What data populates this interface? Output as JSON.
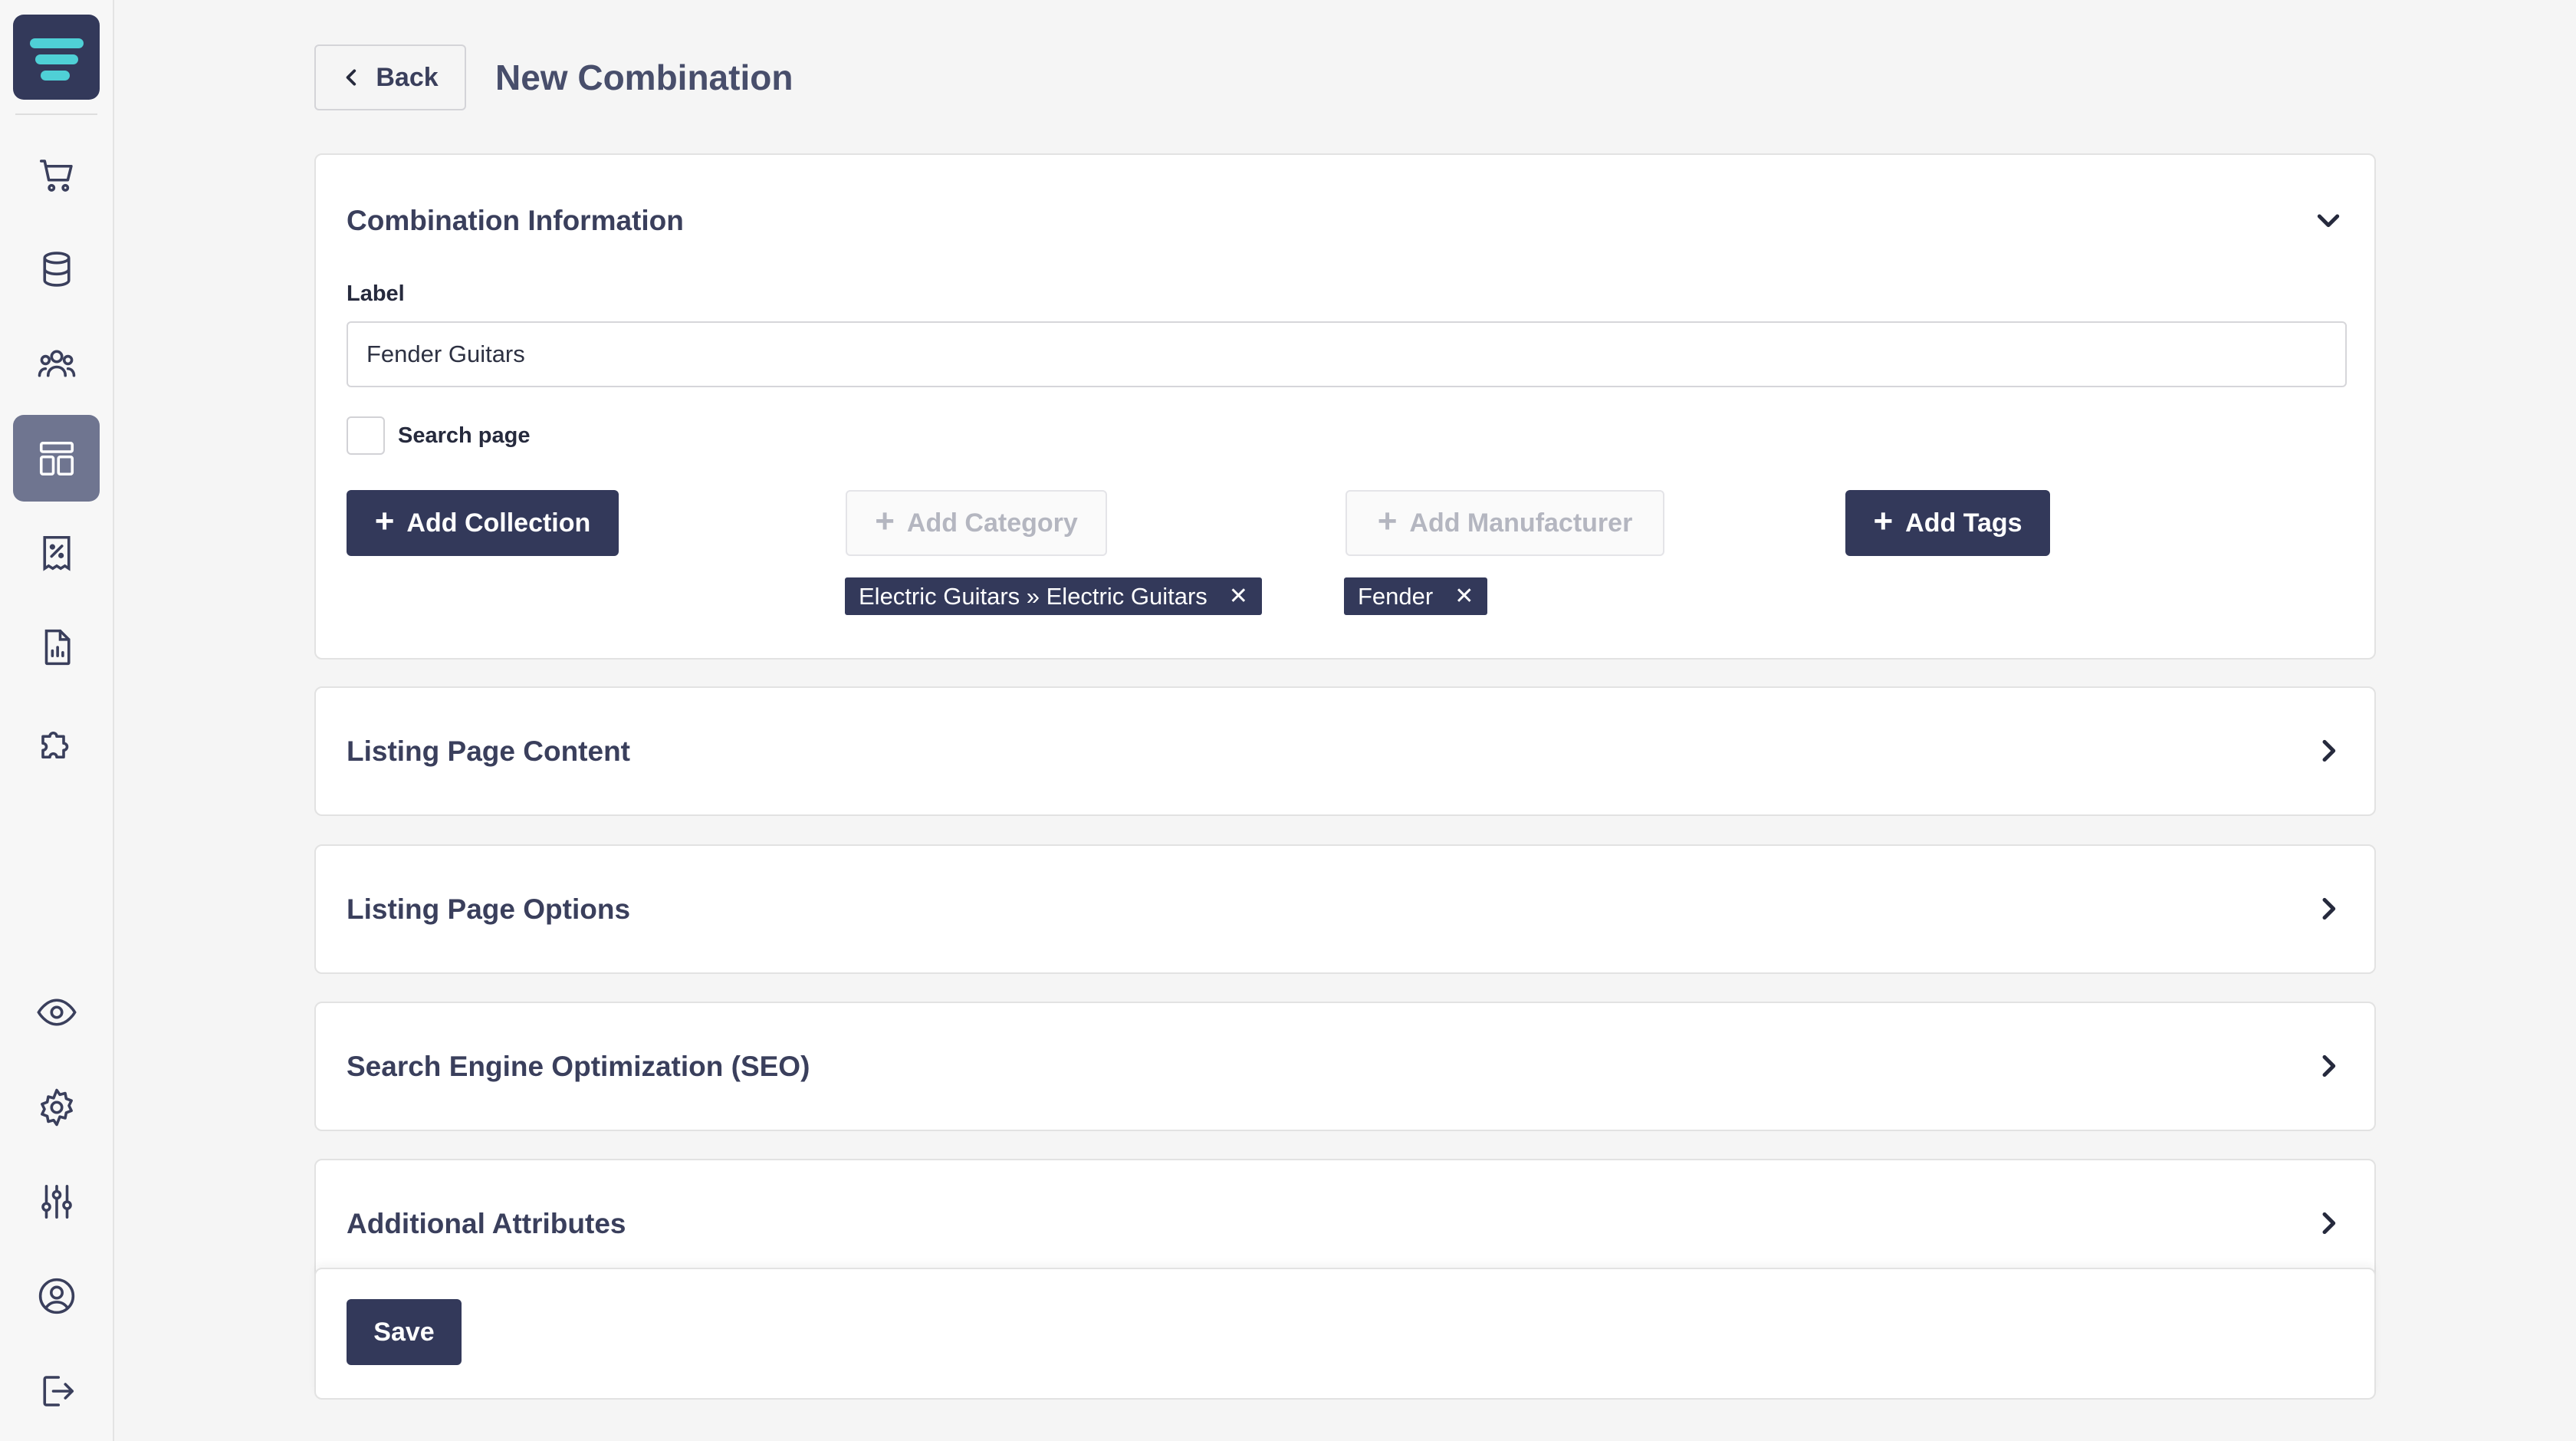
{
  "header": {
    "back_label": "Back",
    "page_title": "New Combination"
  },
  "combination_info": {
    "title": "Combination Information",
    "label_field_label": "Label",
    "label_value": "Fender Guitars",
    "search_page_label": "Search page",
    "search_page_checked": false,
    "add_collection_label": "Add Collection",
    "add_category_label": "Add Category",
    "add_manufacturer_label": "Add Manufacturer",
    "add_tags_label": "Add Tags",
    "category_tag": "Electric Guitars » Electric Guitars",
    "manufacturer_tag": "Fender"
  },
  "sections": {
    "listing_page_content": "Listing Page Content",
    "listing_page_options": "Listing Page Options",
    "seo": "Search Engine Optimization (SEO)",
    "additional_attributes": "Additional Attributes"
  },
  "footer": {
    "save_label": "Save"
  },
  "sidebar": {
    "icons": [
      "cart-icon",
      "database-icon",
      "users-icon",
      "layout-icon",
      "discount-receipt-icon",
      "report-icon",
      "puzzle-icon",
      "eye-icon",
      "gear-icon",
      "sliders-icon",
      "user-circle-icon",
      "logout-icon"
    ]
  },
  "colors": {
    "primary": "#33395a",
    "logo_accent": "#4fd0d6",
    "active_nav": "#6f7590",
    "background": "#f5f5f5"
  }
}
